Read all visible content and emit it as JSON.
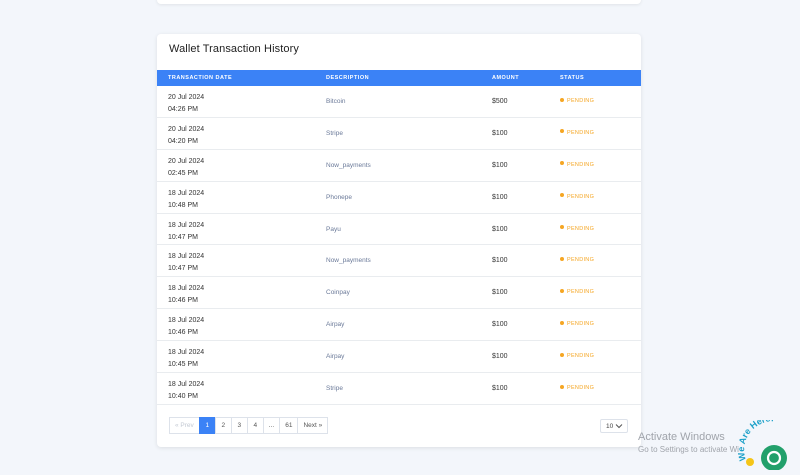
{
  "card": {
    "title": "Wallet Transaction History"
  },
  "table": {
    "headers": [
      "TRANSACTION DATE",
      "DESCRIPTION",
      "AMOUNT",
      "STATUS"
    ],
    "rows": [
      {
        "date": "20 Jul 2024",
        "time": "04:26 PM",
        "description": "Bitcoin",
        "amount": "$500",
        "status": "PENDING"
      },
      {
        "date": "20 Jul 2024",
        "time": "04:20 PM",
        "description": "Stripe",
        "amount": "$100",
        "status": "PENDING"
      },
      {
        "date": "20 Jul 2024",
        "time": "02:45 PM",
        "description": "Now_payments",
        "amount": "$100",
        "status": "PENDING"
      },
      {
        "date": "18 Jul 2024",
        "time": "10:48 PM",
        "description": "Phonepe",
        "amount": "$100",
        "status": "PENDING"
      },
      {
        "date": "18 Jul 2024",
        "time": "10:47 PM",
        "description": "Payu",
        "amount": "$100",
        "status": "PENDING"
      },
      {
        "date": "18 Jul 2024",
        "time": "10:47 PM",
        "description": "Now_payments",
        "amount": "$100",
        "status": "PENDING"
      },
      {
        "date": "18 Jul 2024",
        "time": "10:46 PM",
        "description": "Coinpay",
        "amount": "$100",
        "status": "PENDING"
      },
      {
        "date": "18 Jul 2024",
        "time": "10:46 PM",
        "description": "Airpay",
        "amount": "$100",
        "status": "PENDING"
      },
      {
        "date": "18 Jul 2024",
        "time": "10:45 PM",
        "description": "Airpay",
        "amount": "$100",
        "status": "PENDING"
      },
      {
        "date": "18 Jul 2024",
        "time": "10:40 PM",
        "description": "Stripe",
        "amount": "$100",
        "status": "PENDING"
      }
    ]
  },
  "pagination": {
    "prev": "« Prev",
    "pages": [
      "1",
      "2",
      "3",
      "4",
      "...",
      "61"
    ],
    "active": "1",
    "next": "Next »"
  },
  "per_page": {
    "value": "10"
  },
  "watermark": {
    "line1": "Activate Windows",
    "line2": "Go to Settings to activate Wi"
  },
  "chat_widget": {
    "label": "We Are Here!"
  },
  "colors": {
    "accent": "#3b82f6",
    "pending": "#f5a623",
    "background": "#f3f6fb"
  }
}
